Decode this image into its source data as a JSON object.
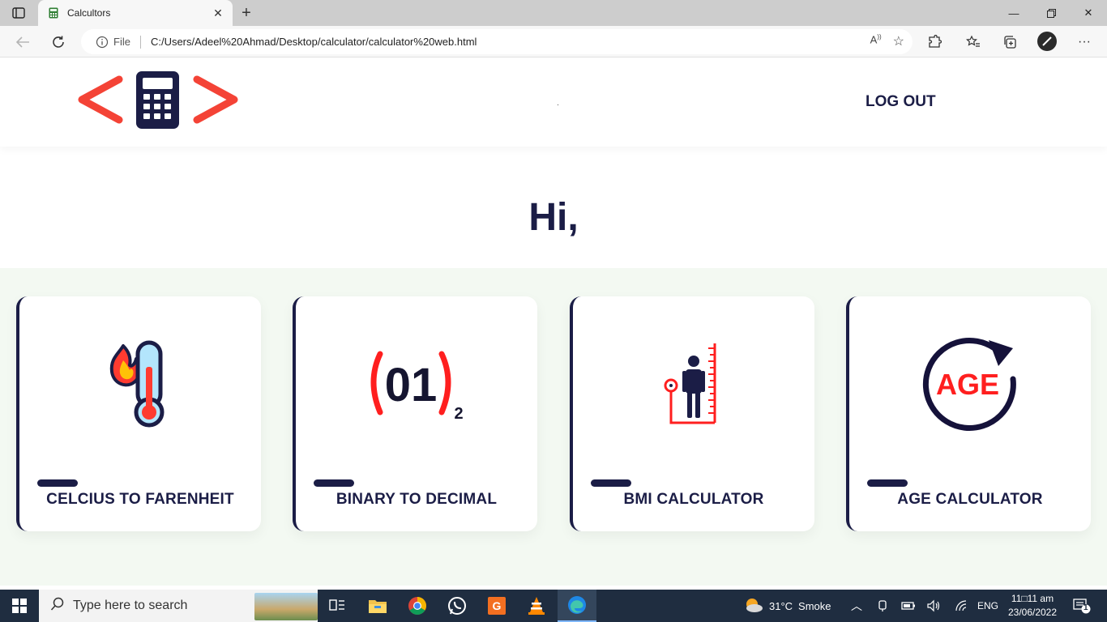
{
  "browser": {
    "tab_title": "Calcultors",
    "url_scheme_label": "File",
    "url_path": "C:/Users/Adeel%20Ahmad/Desktop/calculator/calculator%20web.html"
  },
  "header": {
    "logout_label": "LOG OUT"
  },
  "greeting": "Hi,",
  "cards": [
    {
      "label": "CELCIUS TO FARENHEIT",
      "icon": "thermometer-fire-icon"
    },
    {
      "label": "BINARY TO DECIMAL",
      "icon": "binary-icon",
      "icon_text": "01",
      "icon_sub": "2"
    },
    {
      "label": "BMI CALCULATOR",
      "icon": "bmi-person-icon"
    },
    {
      "label": "AGE CALCULATOR",
      "icon": "age-cycle-icon",
      "icon_text": "AGE"
    }
  ],
  "taskbar": {
    "search_placeholder": "Type here to search",
    "weather_temp": "31°C",
    "weather_desc": "Smoke",
    "language": "ENG",
    "time": "11□11 am",
    "date": "23/06/2022",
    "notification_count": "1"
  },
  "colors": {
    "navy": "#1b1d46",
    "accent_red": "#f44336",
    "cards_bg": "#f3f9f2",
    "taskbar": "#1f2d40"
  }
}
